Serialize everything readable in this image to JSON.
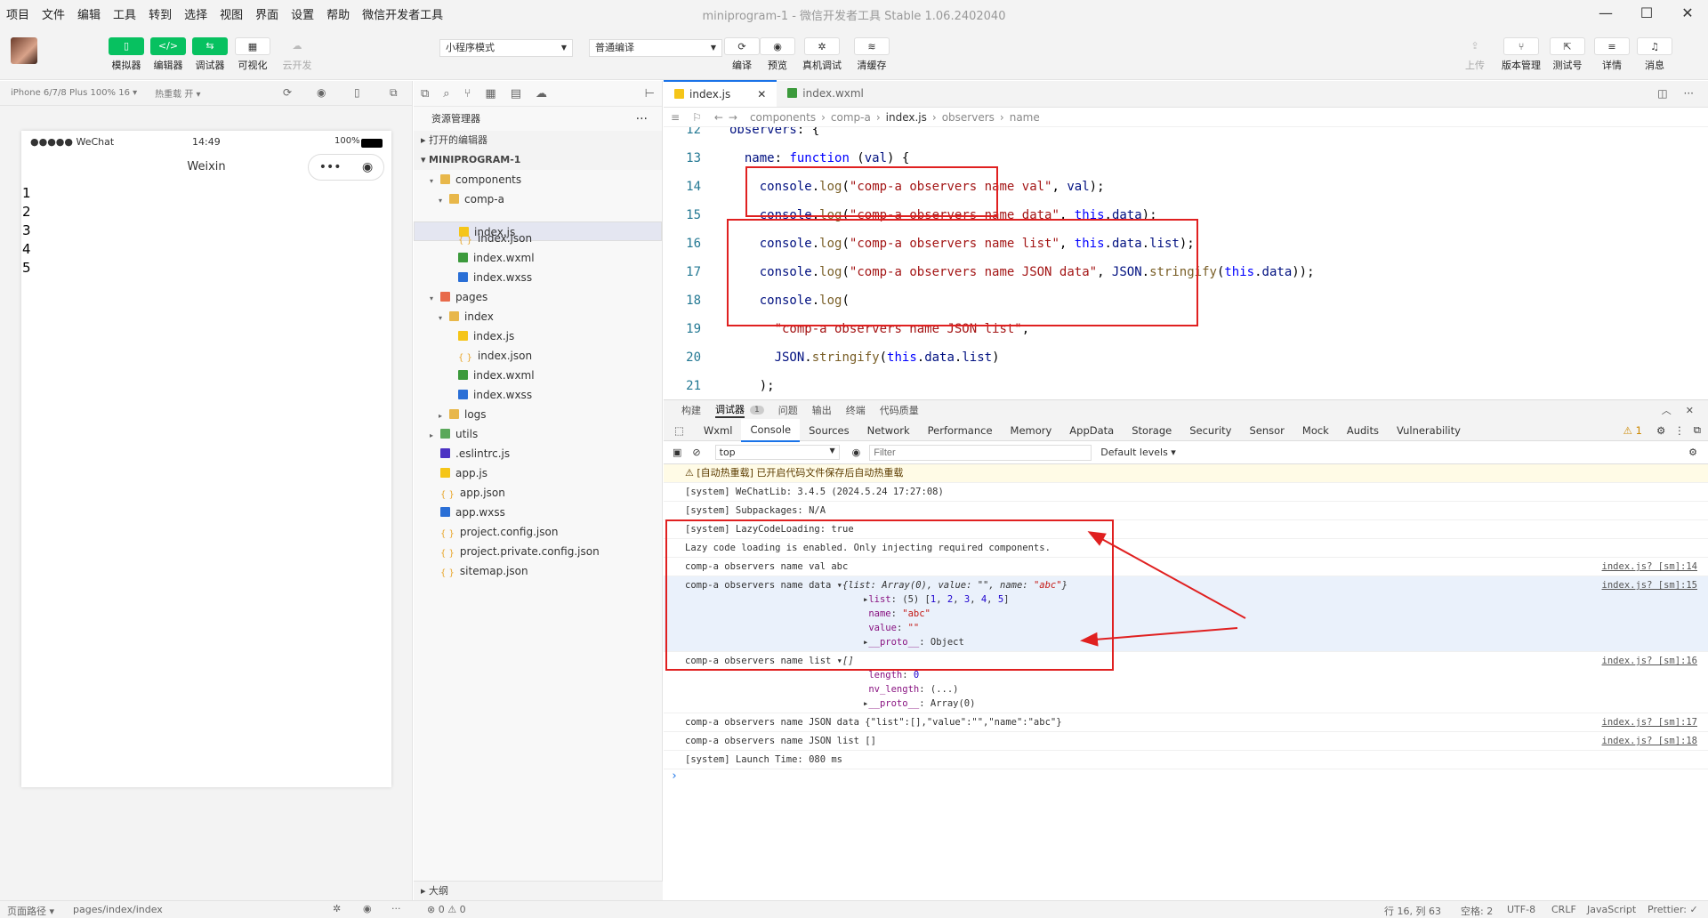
{
  "menu": [
    "项目",
    "文件",
    "编辑",
    "工具",
    "转到",
    "选择",
    "视图",
    "界面",
    "设置",
    "帮助",
    "微信开发者工具"
  ],
  "window_title": "miniprogram-1 - 微信开发者工具 Stable 1.06.2402040",
  "window_controls": [
    "—",
    "☐",
    "✕"
  ],
  "toolbar": {
    "left_buttons": [
      {
        "label": "模拟器",
        "icon": "▯"
      },
      {
        "label": "编辑器",
        "icon": "</>"
      },
      {
        "label": "调试器",
        "icon": "⇆"
      },
      {
        "label": "可视化",
        "icon": "▦"
      },
      {
        "label": "云开发",
        "icon": "☁"
      }
    ],
    "mode_select": "小程序模式",
    "compile_select": "普通编译",
    "mid_buttons": [
      {
        "label": "编译",
        "icon": "⟳"
      },
      {
        "label": "预览",
        "icon": "◉"
      },
      {
        "label": "真机调试",
        "icon": "✲"
      },
      {
        "label": "清缓存",
        "icon": "≋"
      }
    ],
    "right_buttons": [
      {
        "label": "上传",
        "icon": "⇪"
      },
      {
        "label": "版本管理",
        "icon": "⑂"
      },
      {
        "label": "测试号",
        "icon": "⇱"
      },
      {
        "label": "详情",
        "icon": "≡"
      },
      {
        "label": "消息",
        "icon": "♫"
      }
    ]
  },
  "simulator": {
    "device": "iPhone 6/7/8 Plus 100% 16 ▾",
    "hotreload": "热重载 开 ▾",
    "signal": "●●●●● WeChat",
    "time": "14:49",
    "battery": "100%",
    "nav_title": "Weixin",
    "capsule": [
      "•••",
      "◉"
    ],
    "lines": [
      "1",
      "2",
      "3",
      "4",
      "5"
    ]
  },
  "explorer": {
    "title": "资源管理器",
    "open_editors": "打开的编辑器",
    "project": "MINIPROGRAM-1",
    "outline": "大纲",
    "tree": [
      {
        "name": "components",
        "depth": 1,
        "arrow": "▾",
        "type": "folder"
      },
      {
        "name": "comp-a",
        "depth": 2,
        "arrow": "▾",
        "type": "folder"
      },
      {
        "name": "index.js",
        "depth": 3,
        "type": "js",
        "selected": true
      },
      {
        "name": "index.json",
        "depth": 3,
        "type": "json"
      },
      {
        "name": "index.wxml",
        "depth": 3,
        "type": "wxml"
      },
      {
        "name": "index.wxss",
        "depth": 3,
        "type": "wxss"
      },
      {
        "name": "pages",
        "depth": 1,
        "arrow": "▾",
        "type": "folder-red"
      },
      {
        "name": "index",
        "depth": 2,
        "arrow": "▾",
        "type": "folder"
      },
      {
        "name": "index.js",
        "depth": 3,
        "type": "js"
      },
      {
        "name": "index.json",
        "depth": 3,
        "type": "json"
      },
      {
        "name": "index.wxml",
        "depth": 3,
        "type": "wxml"
      },
      {
        "name": "index.wxss",
        "depth": 3,
        "type": "wxss"
      },
      {
        "name": "logs",
        "depth": 2,
        "arrow": "▸",
        "type": "folder"
      },
      {
        "name": "utils",
        "depth": 1,
        "arrow": "▸",
        "type": "folder-green"
      },
      {
        "name": ".eslintrc.js",
        "depth": 1,
        "type": "eslint"
      },
      {
        "name": "app.js",
        "depth": 1,
        "type": "js"
      },
      {
        "name": "app.json",
        "depth": 1,
        "type": "json"
      },
      {
        "name": "app.wxss",
        "depth": 1,
        "type": "wxss"
      },
      {
        "name": "project.config.json",
        "depth": 1,
        "type": "json"
      },
      {
        "name": "project.private.config.json",
        "depth": 1,
        "type": "json"
      },
      {
        "name": "sitemap.json",
        "depth": 1,
        "type": "json"
      }
    ]
  },
  "editor": {
    "tabs": [
      "index.js",
      "index.wxml"
    ],
    "breadcrumb": [
      "components",
      "comp-a",
      "index.js",
      "observers",
      "name"
    ],
    "lines": [
      {
        "n": "12",
        "html": "<span class='prop'>observers</span>: {"
      },
      {
        "n": "13",
        "html": "  <span class='prop'>name</span>: <span class='kw'>function</span> (<span class='prop'>val</span>) {"
      },
      {
        "n": "14",
        "html": "    <span class='prop'>console</span>.<span class='fn'>log</span>(<span class='str'>\"comp-a observers name val\"</span>, <span class='prop'>val</span>);"
      },
      {
        "n": "15",
        "html": "    <span class='prop'>console</span>.<span class='fn'>log</span>(<span class='str'>\"comp-a observers name data\"</span>, <span class='kw'>this</span>.<span class='prop'>data</span>);"
      },
      {
        "n": "16",
        "html": "    <span class='prop'>console</span>.<span class='fn'>log</span>(<span class='str'>\"comp-a observers name list\"</span>, <span class='kw'>this</span>.<span class='prop'>data</span>.<span class='prop'>list</span>);"
      },
      {
        "n": "17",
        "html": "    <span class='prop'>console</span>.<span class='fn'>log</span>(<span class='str'>\"comp-a observers name JSON data\"</span>, <span class='prop'>JSON</span>.<span class='fn'>stringify</span>(<span class='kw'>this</span>.<span class='prop'>data</span>));"
      },
      {
        "n": "18",
        "html": "    <span class='prop'>console</span>.<span class='fn'>log</span>("
      },
      {
        "n": "19",
        "html": "      <span class='str'>\"comp-a observers name JSON list\"</span>,"
      },
      {
        "n": "20",
        "html": "      <span class='prop'>JSON</span>.<span class='fn'>stringify</span>(<span class='kw'>this</span>.<span class='prop'>data</span>.<span class='prop'>list</span>)"
      },
      {
        "n": "21",
        "html": "    );"
      }
    ]
  },
  "panel": {
    "tabs": [
      "构建",
      "调试器",
      "问题",
      "输出",
      "终端",
      "代码质量"
    ],
    "debugger_badge": "1",
    "devtools_tabs": [
      "Wxml",
      "Console",
      "Sources",
      "Network",
      "Performance",
      "Memory",
      "AppData",
      "Storage",
      "Security",
      "Sensor",
      "Mock",
      "Audits",
      "Vulnerability"
    ],
    "warn_count": "⚠ 1",
    "context": "top",
    "filter_placeholder": "Filter",
    "levels": "Default levels ▾",
    "console": [
      {
        "cls": "warn",
        "html": "⚠ [自动热重载] 已开启代码文件保存后自动热重载",
        "src": ""
      },
      {
        "cls": "",
        "html": "[system] WeChatLib: 3.4.5 (2024.5.24 17:27:08)",
        "src": ""
      },
      {
        "cls": "",
        "html": "[system] Subpackages: N/A",
        "src": ""
      },
      {
        "cls": "",
        "html": "[system] LazyCodeLoading: true",
        "src": ""
      },
      {
        "cls": "",
        "html": "Lazy code loading is enabled. Only injecting required components.",
        "src": ""
      },
      {
        "cls": "",
        "html": "comp-a observers name val abc",
        "src": "index.js? [sm]:14"
      },
      {
        "cls": "hl",
        "html": "comp-a observers name data ▾<i>{list: Array(0), value: \"\", name: <span class='redv'>\"abc\"</span>}</i>\n<span class='sub'>▸<span class='purple'>list</span>: (5) [<span class='blue'>1</span>, <span class='blue'>2</span>, <span class='blue'>3</span>, <span class='blue'>4</span>, <span class='blue'>5</span>]</span>\n<span class='sub'> <span class='purple'>name</span>: <span class='redv'>\"abc\"</span></span>\n<span class='sub'> <span class='purple'>value</span>: <span class='redv'>\"\"</span></span>\n<span class='sub'>▸<span class='purple'>__proto__</span>: Object</span>",
        "src": "index.js? [sm]:15"
      },
      {
        "cls": "",
        "html": "comp-a observers name list ▾<i>[]</i>\n<span class='sub'> <span class='purple'>length</span>: <span class='blue'>0</span></span>\n<span class='sub'> <span class='purple'>nv_length</span>: (...)</span>\n<span class='sub'>▸<span class='purple'>__proto__</span>: Array(0)</span>",
        "src": "index.js? [sm]:16"
      },
      {
        "cls": "",
        "html": "comp-a observers name JSON data {\"list\":[],\"value\":\"\",\"name\":\"abc\"}",
        "src": "index.js? [sm]:17"
      },
      {
        "cls": "",
        "html": "comp-a observers name JSON list []",
        "src": "index.js? [sm]:18"
      },
      {
        "cls": "",
        "html": "[system] Launch Time: 080 ms",
        "src": ""
      }
    ],
    "prompt": "›"
  },
  "status": {
    "left_path": "页面路径 ▾",
    "page": "pages/index/index",
    "errors": "⊗ 0 ⚠ 0",
    "cursor": "行 16, 列 63",
    "spaces": "空格: 2",
    "encoding": "UTF-8",
    "eol": "CRLF",
    "lang": "JavaScript",
    "prettier": "Prettier: ✓"
  }
}
